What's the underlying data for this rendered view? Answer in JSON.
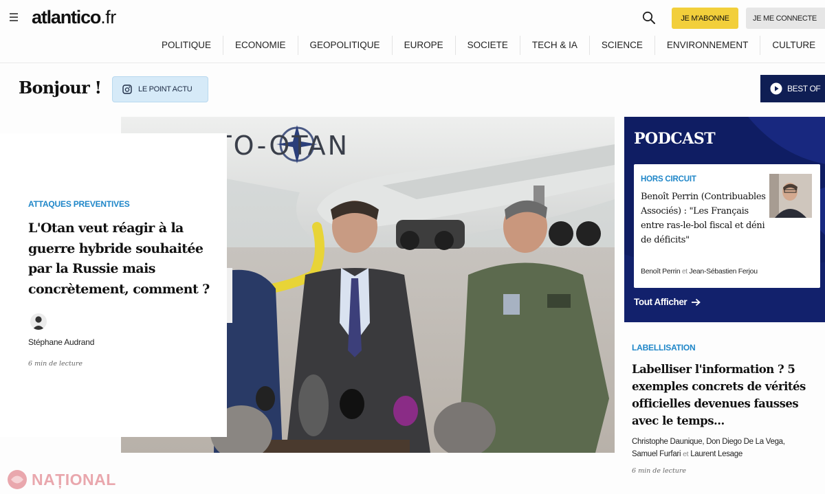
{
  "header": {
    "logo_main": "atlantico",
    "logo_tld": ".fr",
    "subscribe_label": "JE M'ABONNE",
    "login_label": "JE ME CONNECTE",
    "nav": [
      "POLITIQUE",
      "ECONOMIE",
      "GEOPOLITIQUE",
      "EUROPE",
      "SOCIETE",
      "TECH & IA",
      "SCIENCE",
      "ENVIRONNEMENT",
      "CULTURE"
    ]
  },
  "greeting": "Bonjour !",
  "point_actu_label": "LE POINT ACTU",
  "best_of_label": "BEST OF",
  "hero": {
    "photo_text": "NATO-OTAN",
    "kicker": "ATTAQUES PREVENTIVES",
    "title": "L'Otan veut réagir à la guerre hybride souhaitée par la Russie mais concrètement, comment ?",
    "author": "Stéphane Audrand",
    "readtime": "6 min de lecture"
  },
  "podcast": {
    "title": "PODCAST",
    "kicker": "HORS CIRCUIT",
    "headline": "Benoît Perrin (Contribuables Associés) : \"Les Français entre ras-le-bol fiscal et déni de déficits\"",
    "author_1": "Benoît Perrin",
    "author_sep": "et",
    "author_2": "Jean-Sébastien Ferjou",
    "more_label": "Tout Afficher"
  },
  "side_article": {
    "kicker": "LABELLISATION",
    "title": "Labelliser l'information ? 5 exemples concrets de vérités officielles devenues fausses avec le temps...",
    "authors_line_1": "Christophe Daunique, Don Diego De La Vega,",
    "author_3": "Samuel Furfari",
    "author_sep": "et",
    "author_4": "Laurent Lesage",
    "readtime": "6 min de lecture"
  },
  "watermark": "NAȚIONAL",
  "colors": {
    "accent_blue": "#1e86c8",
    "navy": "#0f1e54",
    "subscribe_yellow": "#f2cf3b"
  }
}
